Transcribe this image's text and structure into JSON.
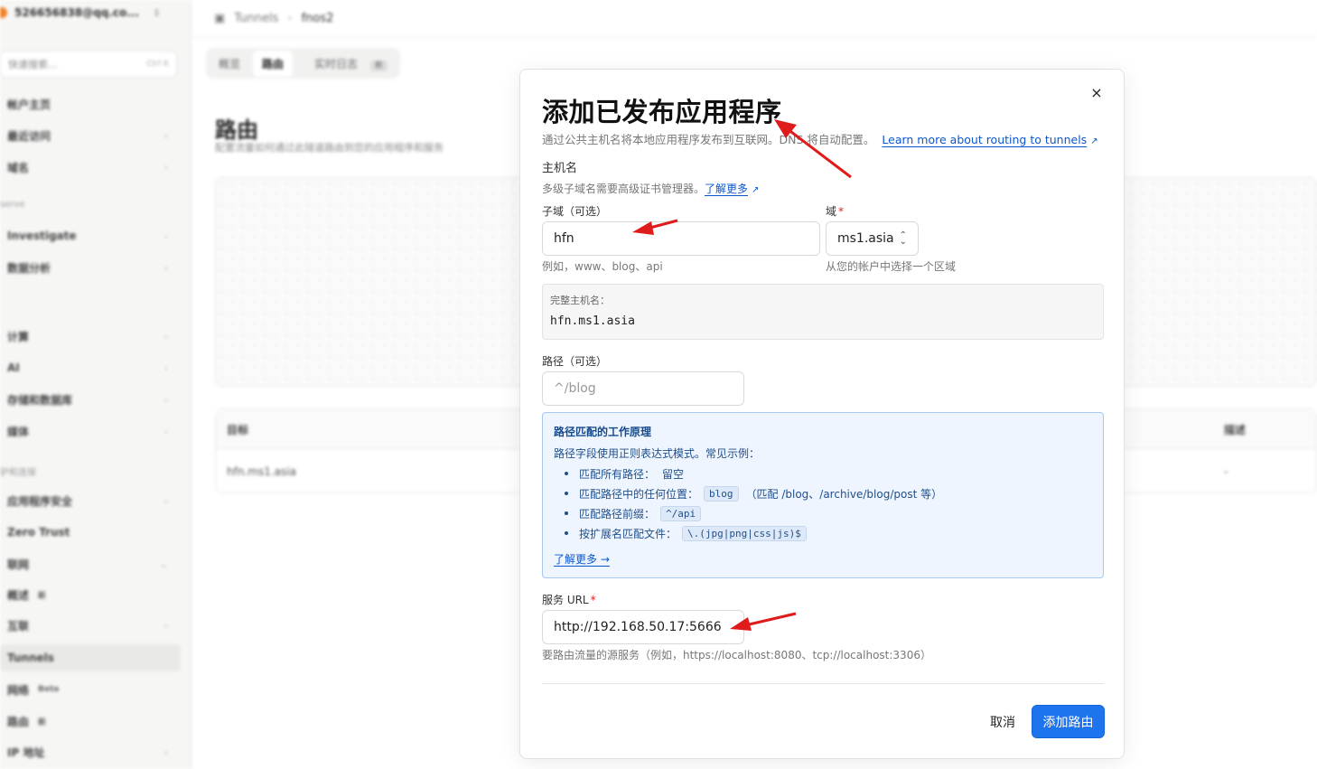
{
  "background": {
    "account": "526656838@qq.co...",
    "breadcrumb": [
      "Tunnels",
      "fnos2"
    ],
    "quick_search": {
      "placeholder": "快速搜索...",
      "shortcut": "Ctrl K"
    },
    "nav_items": [
      {
        "label": "帐户主页",
        "chev": ""
      },
      {
        "label": "最近访问",
        "chev": "›"
      },
      {
        "label": "域名",
        "chev": "›"
      },
      {
        "label": "Investigate",
        "chev": "›"
      },
      {
        "label": "数据分析",
        "chev": "›"
      },
      {
        "label": "计算",
        "chev": "›"
      },
      {
        "label": "AI",
        "chev": "›"
      },
      {
        "label": "存储和数据库",
        "chev": "›"
      },
      {
        "label": "媒体",
        "chev": "›"
      },
      {
        "label": "应用程序安全",
        "chev": "›"
      },
      {
        "label": "Zero Trust",
        "chev": ""
      },
      {
        "label": "联网",
        "chev": "⌄"
      },
      {
        "label": "概述",
        "chev": ""
      },
      {
        "label": "互联",
        "chev": "›"
      },
      {
        "label": "Tunnels",
        "chev": ""
      },
      {
        "label": "网络",
        "chev": ""
      },
      {
        "label": "路由",
        "chev": ""
      },
      {
        "label": "IP 地址",
        "chev": "›"
      }
    ],
    "nav_sections": [
      "serve",
      "护和连接"
    ],
    "nav_tags": {
      "overview": "新",
      "network": "Beta",
      "routes": "新"
    },
    "tabs": [
      {
        "label": "概览"
      },
      {
        "label": "路由"
      },
      {
        "label": "实时日志",
        "badge": "新"
      }
    ],
    "page_title": "路由",
    "page_subtitle": "配置流量如何通过此隧道路由到您的应用程序和服务",
    "table": {
      "headers": [
        "目标",
        "描述"
      ],
      "row": [
        "hfn.ms1.asia",
        "-"
      ]
    }
  },
  "modal": {
    "close_icon": "×",
    "title": "添加已发布应用程序",
    "description": "通过公共主机名将本地应用程序发布到互联网。DNS 将自动配置。",
    "learn_more_routing": "Learn more about routing to tunnels",
    "hostname": {
      "label": "主机名",
      "hint": "多级子域名需要高级证书管理器。",
      "learn_more": "了解更多"
    },
    "subdomain": {
      "label": "子域（可选）",
      "value": "hfn",
      "hint": "例如，www、blog、api"
    },
    "domain": {
      "label": "域",
      "required": "*",
      "value": "ms1.asia",
      "hint": "从您的帐户中选择一个区域"
    },
    "full_hostname": {
      "label": "完整主机名：",
      "value": "hfn.ms1.asia"
    },
    "path": {
      "label": "路径（可选）",
      "placeholder": "^/blog"
    },
    "info": {
      "title": "路径匹配的工作原理",
      "subtitle": "路径字段使用正则表达式模式。常见示例：",
      "items": [
        {
          "text": "匹配所有路径：",
          "code": "",
          "after": "留空"
        },
        {
          "text": "匹配路径中的任何位置：",
          "code": "blog",
          "after": "（匹配 /blog、/archive/blog/post 等）"
        },
        {
          "text": "匹配路径前缀：",
          "code": "^/api",
          "after": ""
        },
        {
          "text": "按扩展名匹配文件：",
          "code": "\\.(jpg|png|css|js)$",
          "after": ""
        }
      ],
      "learn_more": "了解更多 →"
    },
    "service_url": {
      "label": "服务 URL",
      "required": "*",
      "value": "http://192.168.50.17:5666",
      "hint": "要路由流量的源服务（例如，https://localhost:8080、tcp://localhost:3306）"
    },
    "cancel": "取消",
    "submit": "添加路由"
  },
  "annotation_color": "#e01b1b",
  "accent_color": "#1e74ec"
}
